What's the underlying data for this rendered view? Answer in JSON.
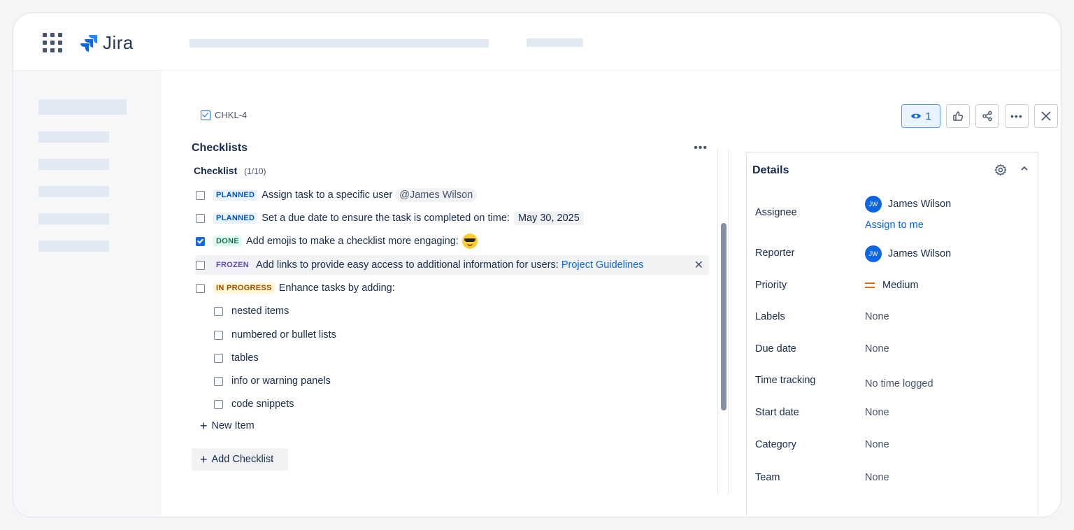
{
  "app": {
    "name": "Jira"
  },
  "issue": {
    "key": "CHKL-4"
  },
  "toolbar": {
    "watch_count": "1"
  },
  "checklists": {
    "title": "Checklists",
    "more": "•••",
    "checklist": {
      "name": "Checklist",
      "count": "(1/10)"
    },
    "items": [
      {
        "status": "PLANNED",
        "text": "Assign task to a specific user",
        "mention": "@James Wilson"
      },
      {
        "status": "PLANNED",
        "text": "Set a due date to ensure the task is completed on time:",
        "date": "May 30, 2025"
      },
      {
        "status": "DONE",
        "text": "Add emojis to make a checklist more engaging:"
      },
      {
        "status": "FROZEN",
        "text": "Add links to provide easy access to additional information for users:",
        "link": "Project Guidelines"
      },
      {
        "status": "IN PROGRESS",
        "text": "Enhance tasks by adding:"
      },
      {
        "text": "nested items"
      },
      {
        "text": "numbered or bullet lists"
      },
      {
        "text": "tables"
      },
      {
        "text": "info or warning panels"
      },
      {
        "text": "code snippets"
      }
    ],
    "new_item": "New Item",
    "add_checklist": "Add Checklist",
    "close_glyph": "✕"
  },
  "details": {
    "title": "Details",
    "assignee": {
      "label": "Assignee",
      "initials": "JW",
      "name": "James Wilson",
      "assign_link": "Assign to me"
    },
    "reporter": {
      "label": "Reporter",
      "initials": "JW",
      "name": "James Wilson"
    },
    "priority": {
      "label": "Priority",
      "value": "Medium",
      "color": "#e56910"
    },
    "labels": {
      "label": "Labels",
      "value": "None"
    },
    "due_date": {
      "label": "Due date",
      "value": "None"
    },
    "time_tracking": {
      "label": "Time tracking",
      "value": "No time logged"
    },
    "start_date": {
      "label": "Start date",
      "value": "None"
    },
    "category": {
      "label": "Category",
      "value": "None"
    },
    "team": {
      "label": "Team",
      "value": "None"
    }
  },
  "colors": {
    "accent": "#0c66e4",
    "done_checkbox": "#1868db"
  }
}
